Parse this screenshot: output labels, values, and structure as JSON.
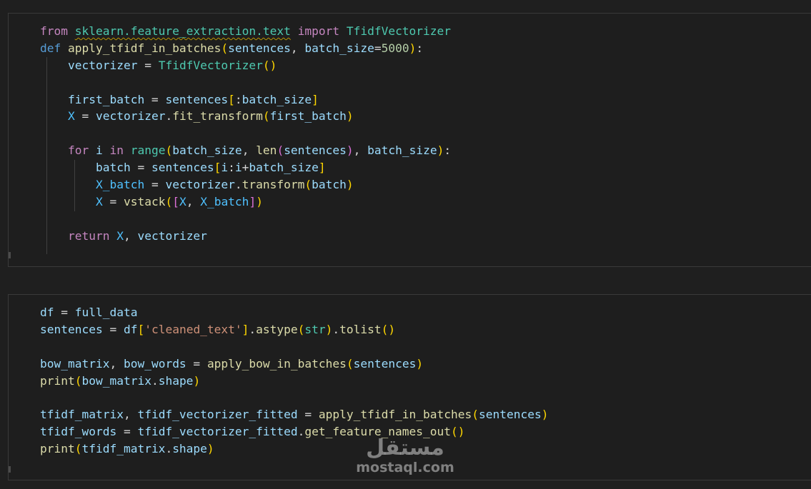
{
  "cells": [
    {
      "lines": [
        [
          [
            "from",
            "kw"
          ],
          [
            " ",
            ""
          ],
          [
            "sklearn.feature_extraction.text",
            "cls squig"
          ],
          [
            " ",
            ""
          ],
          [
            "import",
            "kw"
          ],
          [
            " ",
            ""
          ],
          [
            "TfidfVectorizer",
            "cls"
          ]
        ],
        [
          [
            "def",
            "def"
          ],
          [
            " ",
            ""
          ],
          [
            "apply_tfidf_in_batches",
            "fn"
          ],
          [
            "(",
            "br1"
          ],
          [
            "sentences",
            "var"
          ],
          [
            ", ",
            ""
          ],
          [
            "batch_size",
            "var"
          ],
          [
            "=",
            ""
          ],
          [
            "5000",
            "num"
          ],
          [
            ")",
            "br1"
          ],
          [
            ":",
            ""
          ]
        ],
        [
          [
            "    ",
            ""
          ],
          [
            "vectorizer",
            "var"
          ],
          [
            " = ",
            ""
          ],
          [
            "TfidfVectorizer",
            "cls"
          ],
          [
            "()",
            "br1"
          ]
        ],
        [],
        [
          [
            "    ",
            ""
          ],
          [
            "first_batch",
            "var"
          ],
          [
            " = ",
            ""
          ],
          [
            "sentences",
            "var"
          ],
          [
            "[",
            "br1"
          ],
          [
            ":",
            ""
          ],
          [
            "batch_size",
            "var"
          ],
          [
            "]",
            "br1"
          ]
        ],
        [
          [
            "    ",
            ""
          ],
          [
            "X",
            "const"
          ],
          [
            " = ",
            ""
          ],
          [
            "vectorizer",
            "var"
          ],
          [
            ".",
            ""
          ],
          [
            "fit_transform",
            "fn"
          ],
          [
            "(",
            "br1"
          ],
          [
            "first_batch",
            "var"
          ],
          [
            ")",
            "br1"
          ]
        ],
        [],
        [
          [
            "    ",
            ""
          ],
          [
            "for",
            "kw"
          ],
          [
            " ",
            ""
          ],
          [
            "i",
            "var"
          ],
          [
            " ",
            ""
          ],
          [
            "in",
            "kw"
          ],
          [
            " ",
            ""
          ],
          [
            "range",
            "cls"
          ],
          [
            "(",
            "br1"
          ],
          [
            "batch_size",
            "var"
          ],
          [
            ", ",
            ""
          ],
          [
            "len",
            "fn"
          ],
          [
            "(",
            "br2"
          ],
          [
            "sentences",
            "var"
          ],
          [
            ")",
            "br2"
          ],
          [
            ", ",
            ""
          ],
          [
            "batch_size",
            "var"
          ],
          [
            ")",
            "br1"
          ],
          [
            ":",
            ""
          ]
        ],
        [
          [
            "        ",
            ""
          ],
          [
            "batch",
            "var"
          ],
          [
            " = ",
            ""
          ],
          [
            "sentences",
            "var"
          ],
          [
            "[",
            "br1"
          ],
          [
            "i",
            "var"
          ],
          [
            ":",
            ""
          ],
          [
            "i",
            "var"
          ],
          [
            "+",
            ""
          ],
          [
            "batch_size",
            "var"
          ],
          [
            "]",
            "br1"
          ]
        ],
        [
          [
            "        ",
            ""
          ],
          [
            "X_batch",
            "const"
          ],
          [
            " = ",
            ""
          ],
          [
            "vectorizer",
            "var"
          ],
          [
            ".",
            ""
          ],
          [
            "transform",
            "fn"
          ],
          [
            "(",
            "br1"
          ],
          [
            "batch",
            "var"
          ],
          [
            ")",
            "br1"
          ]
        ],
        [
          [
            "        ",
            ""
          ],
          [
            "X",
            "const"
          ],
          [
            " = ",
            ""
          ],
          [
            "vstack",
            "fn"
          ],
          [
            "(",
            "br1"
          ],
          [
            "[",
            "br2"
          ],
          [
            "X",
            "const"
          ],
          [
            ", ",
            ""
          ],
          [
            "X_batch",
            "const"
          ],
          [
            "]",
            "br2"
          ],
          [
            ")",
            "br1"
          ]
        ],
        [],
        [
          [
            "    ",
            ""
          ],
          [
            "return",
            "kw"
          ],
          [
            " ",
            ""
          ],
          [
            "X",
            "const"
          ],
          [
            ", ",
            ""
          ],
          [
            "vectorizer",
            "var"
          ]
        ]
      ]
    },
    {
      "lines": [
        [
          [
            "df",
            "var"
          ],
          [
            " = ",
            ""
          ],
          [
            "full_data",
            "var"
          ]
        ],
        [
          [
            "sentences",
            "var"
          ],
          [
            " = ",
            ""
          ],
          [
            "df",
            "var"
          ],
          [
            "[",
            "br1"
          ],
          [
            "'cleaned_text'",
            "str"
          ],
          [
            "]",
            "br1"
          ],
          [
            ".",
            ""
          ],
          [
            "astype",
            "fn"
          ],
          [
            "(",
            "br1"
          ],
          [
            "str",
            "cls"
          ],
          [
            ")",
            "br1"
          ],
          [
            ".",
            ""
          ],
          [
            "tolist",
            "fn"
          ],
          [
            "()",
            "br1"
          ]
        ],
        [],
        [
          [
            "bow_matrix",
            "var"
          ],
          [
            ", ",
            ""
          ],
          [
            "bow_words",
            "var"
          ],
          [
            " = ",
            ""
          ],
          [
            "apply_bow_in_batches",
            "fn"
          ],
          [
            "(",
            "br1"
          ],
          [
            "sentences",
            "var"
          ],
          [
            ")",
            "br1"
          ]
        ],
        [
          [
            "print",
            "fn"
          ],
          [
            "(",
            "br1"
          ],
          [
            "bow_matrix",
            "var"
          ],
          [
            ".",
            ""
          ],
          [
            "shape",
            "var"
          ],
          [
            ")",
            "br1"
          ]
        ],
        [],
        [
          [
            "tfidf_matrix",
            "var"
          ],
          [
            ", ",
            ""
          ],
          [
            "tfidf_vectorizer_fitted",
            "var"
          ],
          [
            " = ",
            ""
          ],
          [
            "apply_tfidf_in_batches",
            "fn"
          ],
          [
            "(",
            "br1"
          ],
          [
            "sentences",
            "var"
          ],
          [
            ")",
            "br1"
          ]
        ],
        [
          [
            "tfidf_words",
            "var"
          ],
          [
            " = ",
            ""
          ],
          [
            "tfidf_vectorizer_fitted",
            "var"
          ],
          [
            ".",
            ""
          ],
          [
            "get_feature_names_out",
            "fn"
          ],
          [
            "()",
            "br1"
          ]
        ],
        [
          [
            "print",
            "fn"
          ],
          [
            "(",
            "br1"
          ],
          [
            "tfidf_matrix",
            "var"
          ],
          [
            ".",
            ""
          ],
          [
            "shape",
            "var"
          ],
          [
            ")",
            "br1"
          ]
        ]
      ]
    }
  ],
  "watermark": {
    "arabic": "مستقل",
    "latin": "mostaql.com"
  }
}
